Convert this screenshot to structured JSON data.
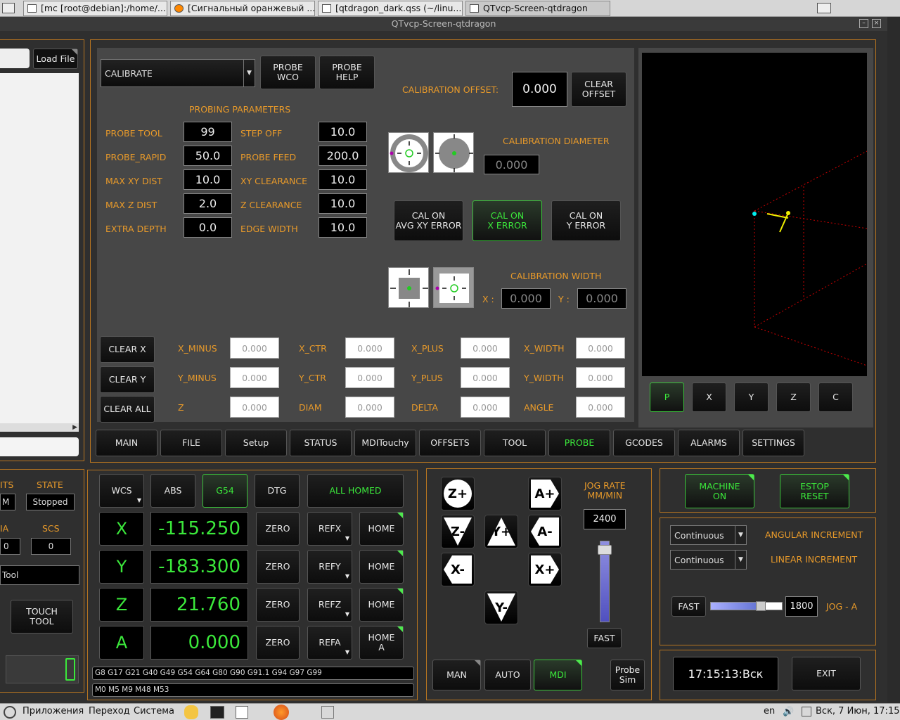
{
  "tabs": [
    "[mc [root@debian]:/home/...",
    "[Сигнальный оранжевый ...",
    "[qtdragon_dark.qss (~/linu...",
    "QTvcp-Screen-qtdragon"
  ],
  "window_title": "QTvcp-Screen-qtdragon",
  "left": {
    "load_file": "Load File",
    "col1": "ITS",
    "state_label": "STATE",
    "state_value": "Stopped",
    "m_value": "M",
    "ia_label": "IA",
    "scs_label": "SCS",
    "ia_value": "0",
    "scs_value": "0",
    "tool_value": "Tool",
    "touch_tool": "TOUCH\nTOOL"
  },
  "probe": {
    "mode": "CALIBRATE",
    "probe_wco": "PROBE\nWCO",
    "probe_help": "PROBE\nHELP",
    "params_title": "PROBING PARAMETERS",
    "params": [
      {
        "l1": "PROBE TOOL",
        "v1": "99",
        "l2": "STEP OFF",
        "v2": "10.0"
      },
      {
        "l1": "PROBE_RAPID",
        "v1": "50.0",
        "l2": "PROBE FEED",
        "v2": "200.0"
      },
      {
        "l1": "MAX XY DIST",
        "v1": "10.0",
        "l2": "XY CLEARANCE",
        "v2": "10.0"
      },
      {
        "l1": "MAX Z DIST",
        "v1": "2.0",
        "l2": "Z CLEARANCE",
        "v2": "10.0"
      },
      {
        "l1": "EXTRA DEPTH",
        "v1": "0.0",
        "l2": "EDGE WIDTH",
        "v2": "10.0"
      }
    ],
    "cal_offset_label": "CALIBRATION OFFSET:",
    "cal_offset_value": "0.000",
    "clear_offset": "CLEAR\nOFFSET",
    "cal_diam_label": "CALIBRATION DIAMETER",
    "cal_diam_value": "0.000",
    "cal_avg": "CAL ON\nAVG XY ERROR",
    "cal_x": "CAL ON\nX ERROR",
    "cal_y": "CAL ON\nY ERROR",
    "cal_width_label": "CALIBRATION WIDTH",
    "x_label": "X :",
    "y_label": "Y :",
    "cal_wx": "0.000",
    "cal_wy": "0.000",
    "clear_x": "CLEAR X",
    "clear_y": "CLEAR Y",
    "clear_all": "CLEAR ALL",
    "results": [
      [
        "X_MINUS",
        "0.000",
        "X_CTR",
        "0.000",
        "X_PLUS",
        "0.000",
        "X_WIDTH",
        "0.000"
      ],
      [
        "Y_MINUS",
        "0.000",
        "Y_CTR",
        "0.000",
        "Y_PLUS",
        "0.000",
        "Y_WIDTH",
        "0.000"
      ],
      [
        "Z",
        "0.000",
        "DIAM",
        "0.000",
        "DELTA",
        "0.000",
        "ANGLE",
        "0.000"
      ]
    ]
  },
  "view_buttons": [
    "P",
    "X",
    "Y",
    "Z",
    "C"
  ],
  "nav_tabs": [
    "MAIN",
    "FILE",
    "Setup",
    "STATUS",
    "MDITouchy",
    "OFFSETS",
    "TOOL",
    "PROBE",
    "GCODES",
    "ALARMS",
    "SETTINGS"
  ],
  "dro": {
    "wcs": "WCS",
    "abs": "ABS",
    "g54": "G54",
    "dtg": "DTG",
    "all_homed": "ALL HOMED",
    "axes": [
      {
        "n": "X",
        "v": "-115.250",
        "ref": "REFX",
        "home": "HOME"
      },
      {
        "n": "Y",
        "v": "-183.300",
        "ref": "REFY",
        "home": "HOME"
      },
      {
        "n": "Z",
        "v": "21.760",
        "ref": "REFZ",
        "home": "HOME"
      },
      {
        "n": "A",
        "v": "0.000",
        "ref": "REFA",
        "home": "HOME\nA"
      }
    ],
    "zero": "ZERO",
    "gcodes": "G8 G17 G21 G40 G49 G54 G64 G80 G90 G91.1 G94 G97 G99",
    "mcodes": "M0 M5 M9 M48 M53"
  },
  "jog": {
    "zp": "Z+",
    "zm": "Z-",
    "yp": "Y+",
    "ym": "Y-",
    "xp": "X+",
    "xm": "X-",
    "ap": "A+",
    "am": "A-",
    "rate_label": "JOG RATE\nMM/MIN",
    "rate": "2400",
    "fast": "FAST",
    "slider_fraction": 0.85
  },
  "mode": {
    "man": "MAN",
    "auto": "AUTO",
    "mdi": "MDI",
    "probe_sim": "Probe\nSim"
  },
  "machine": {
    "on": "MACHINE\nON",
    "estop": "ESTOP\nRESET",
    "ang_sel": "Continuous",
    "lin_sel": "Continuous",
    "ang_label": "ANGULAR INCREMENT",
    "lin_label": "LINEAR INCREMENT",
    "fast": "FAST",
    "jog_a": "1800",
    "jog_a_label": "JOG - A",
    "jog_a_fraction": 0.7,
    "clock": "17:15:13:Вск",
    "exit": "EXIT"
  },
  "taskbar": {
    "apps": "Приложения",
    "nav": "Переход",
    "sys": "Система",
    "lang": "en",
    "date": "Вск, 7 Июн, 17:15"
  }
}
